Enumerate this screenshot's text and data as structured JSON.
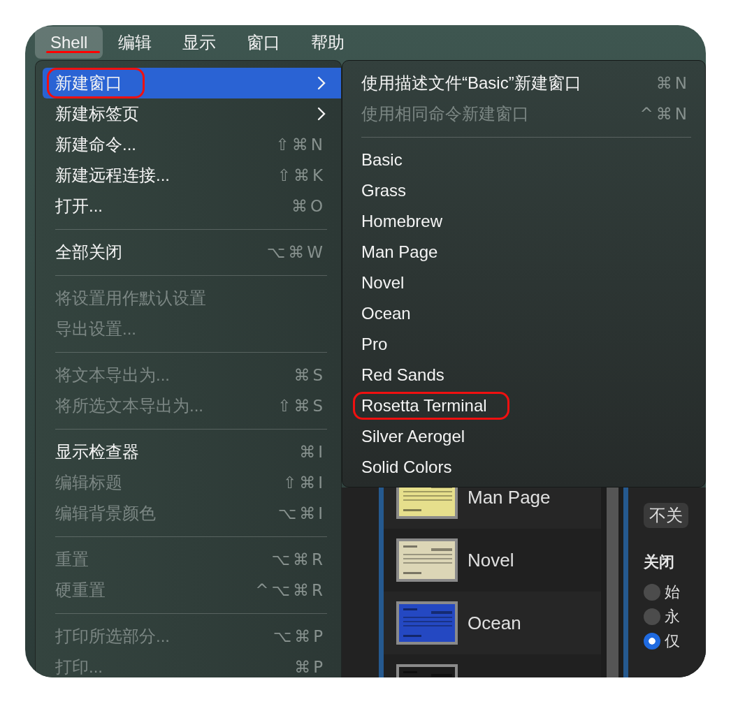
{
  "menubar": [
    {
      "label": "Shell",
      "selected": true,
      "underlined": true
    },
    {
      "label": "编辑",
      "selected": false,
      "underlined": false
    },
    {
      "label": "显示",
      "selected": false,
      "underlined": false
    },
    {
      "label": "窗口",
      "selected": false,
      "underlined": false
    },
    {
      "label": "帮助",
      "selected": false,
      "underlined": false
    }
  ],
  "menu": {
    "items": [
      {
        "kind": "item",
        "label": "新建窗口",
        "submenu": true,
        "disabled": false,
        "selected": true,
        "circled": true
      },
      {
        "kind": "item",
        "label": "新建标签页",
        "submenu": true,
        "disabled": false,
        "selected": false,
        "circled": false
      },
      {
        "kind": "item",
        "label": "新建命令...",
        "shortcut": "⇧⌘N",
        "disabled": false,
        "selected": false,
        "circled": false
      },
      {
        "kind": "item",
        "label": "新建远程连接...",
        "shortcut": "⇧⌘K",
        "disabled": false,
        "selected": false,
        "circled": false
      },
      {
        "kind": "item",
        "label": "打开...",
        "shortcut": "⌘O",
        "disabled": false,
        "selected": false,
        "circled": false
      },
      {
        "kind": "separator"
      },
      {
        "kind": "item",
        "label": "全部关闭",
        "shortcut": "⌥⌘W",
        "disabled": false,
        "selected": false,
        "circled": false
      },
      {
        "kind": "separator"
      },
      {
        "kind": "item",
        "label": "将设置用作默认设置",
        "disabled": true,
        "selected": false,
        "circled": false
      },
      {
        "kind": "item",
        "label": "导出设置...",
        "disabled": true,
        "selected": false,
        "circled": false
      },
      {
        "kind": "separator"
      },
      {
        "kind": "item",
        "label": "将文本导出为...",
        "shortcut": "⌘S",
        "disabled": true,
        "selected": false,
        "circled": false
      },
      {
        "kind": "item",
        "label": "将所选文本导出为...",
        "shortcut": "⇧⌘S",
        "disabled": true,
        "selected": false,
        "circled": false
      },
      {
        "kind": "separator"
      },
      {
        "kind": "item",
        "label": "显示检查器",
        "shortcut": "⌘I",
        "disabled": false,
        "selected": false,
        "circled": false
      },
      {
        "kind": "item",
        "label": "编辑标题",
        "shortcut": "⇧⌘I",
        "disabled": true,
        "selected": false,
        "circled": false
      },
      {
        "kind": "item",
        "label": "编辑背景颜色",
        "shortcut": "⌥⌘I",
        "disabled": true,
        "selected": false,
        "circled": false
      },
      {
        "kind": "separator"
      },
      {
        "kind": "item",
        "label": "重置",
        "shortcut": "⌥⌘R",
        "disabled": true,
        "selected": false,
        "circled": false
      },
      {
        "kind": "item",
        "label": "硬重置",
        "shortcut": "^⌥⌘R",
        "disabled": true,
        "selected": false,
        "circled": false
      },
      {
        "kind": "separator"
      },
      {
        "kind": "item",
        "label": "打印所选部分...",
        "shortcut": "⌥⌘P",
        "disabled": true,
        "selected": false,
        "circled": false
      },
      {
        "kind": "item",
        "label": "打印...",
        "shortcut": "⌘P",
        "disabled": true,
        "selected": false,
        "circled": false
      }
    ]
  },
  "submenu": {
    "items": [
      {
        "kind": "item",
        "label": "使用描述文件“Basic”新建窗口",
        "shortcut": "⌘N",
        "disabled": false,
        "selected": false,
        "circled": false
      },
      {
        "kind": "item",
        "label": "使用相同命令新建窗口",
        "shortcut": "^⌘N",
        "disabled": true,
        "selected": false,
        "circled": false
      },
      {
        "kind": "separator"
      },
      {
        "kind": "item",
        "label": "Basic",
        "disabled": false,
        "selected": false,
        "circled": false
      },
      {
        "kind": "item",
        "label": "Grass",
        "disabled": false,
        "selected": false,
        "circled": false
      },
      {
        "kind": "item",
        "label": "Homebrew",
        "disabled": false,
        "selected": false,
        "circled": false
      },
      {
        "kind": "item",
        "label": "Man Page",
        "disabled": false,
        "selected": false,
        "circled": false
      },
      {
        "kind": "item",
        "label": "Novel",
        "disabled": false,
        "selected": false,
        "circled": false
      },
      {
        "kind": "item",
        "label": "Ocean",
        "disabled": false,
        "selected": false,
        "circled": false
      },
      {
        "kind": "item",
        "label": "Pro",
        "disabled": false,
        "selected": false,
        "circled": false
      },
      {
        "kind": "item",
        "label": "Red Sands",
        "disabled": false,
        "selected": false,
        "circled": false
      },
      {
        "kind": "item",
        "label": "Rosetta Terminal",
        "disabled": false,
        "selected": false,
        "circled": true
      },
      {
        "kind": "item",
        "label": "Silver Aerogel",
        "disabled": false,
        "selected": false,
        "circled": false
      },
      {
        "kind": "item",
        "label": "Solid Colors",
        "disabled": false,
        "selected": false,
        "circled": false
      }
    ]
  },
  "background_window": {
    "profiles": [
      {
        "name": "Man Page",
        "color": "#e6df8c"
      },
      {
        "name": "Novel",
        "color": "#dcd6b6"
      },
      {
        "name": "Ocean",
        "color": "#2448c2"
      },
      {
        "color": "#1c1c1c"
      }
    ],
    "button": "不关",
    "section_label": "关闭",
    "radios": [
      {
        "label": "始",
        "selected": false
      },
      {
        "label": "永",
        "selected": false
      },
      {
        "label": "仅",
        "selected": true
      }
    ]
  }
}
